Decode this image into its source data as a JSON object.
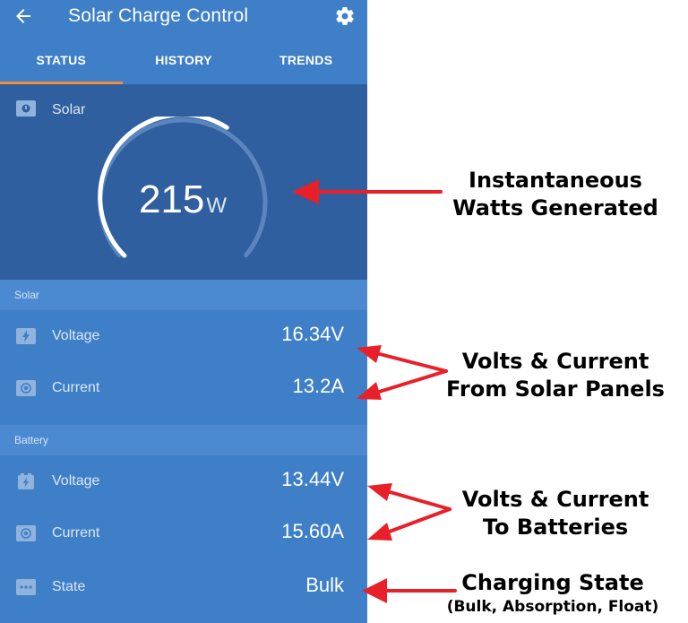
{
  "app": {
    "title": "Solar Charge Control",
    "accent_color": "#3f7fc7",
    "hero_color": "#2f5f9e",
    "tab_indicator_color": "#f08c3a",
    "back_icon": "arrow-left-icon",
    "settings_icon": "gear-icon"
  },
  "tabs": [
    {
      "label": "STATUS",
      "active": true
    },
    {
      "label": "HISTORY",
      "active": false
    },
    {
      "label": "TRENDS",
      "active": false
    }
  ],
  "hero": {
    "label": "Solar",
    "icon": "solar-panel-icon",
    "power_value": "215",
    "power_unit": "W",
    "gauge_fraction": 0.62
  },
  "solar_section": {
    "header": "Solar",
    "rows": [
      {
        "label": "Voltage",
        "value": "16.34V",
        "icon": "lightning-icon"
      },
      {
        "label": "Current",
        "value": "13.2A",
        "icon": "current-icon"
      }
    ]
  },
  "battery_section": {
    "header": "Battery",
    "rows": [
      {
        "label": "Voltage",
        "value": "13.44V",
        "icon": "battery-icon"
      },
      {
        "label": "Current",
        "value": "15.60A",
        "icon": "current-icon"
      },
      {
        "label": "State",
        "value": "Bulk",
        "icon": "more-dots-icon"
      }
    ]
  },
  "annotations": {
    "color": "#e8202a",
    "watts": [
      "Instantaneous",
      "Watts Generated"
    ],
    "solar": [
      "Volts & Current",
      "From Solar Panels"
    ],
    "battery": [
      "Volts & Current",
      "To Batteries"
    ],
    "state": [
      "Charging State",
      "(Bulk, Absorption, Float)"
    ]
  }
}
